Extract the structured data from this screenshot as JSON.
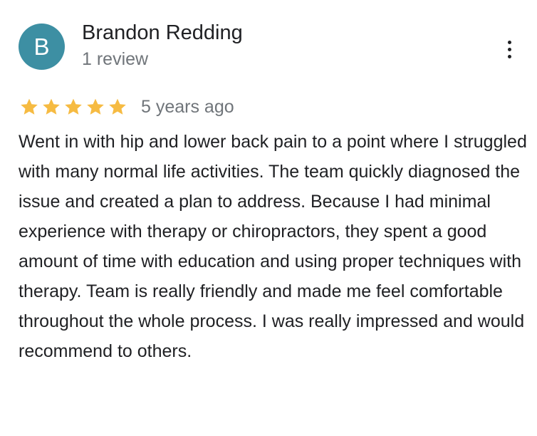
{
  "review": {
    "avatar_letter": "B",
    "avatar_color": "#3d8fa3",
    "reviewer_name": "Brandon Redding",
    "review_count": "1 review",
    "rating": 5,
    "rating_max": 5,
    "star_color": "#f6bb42",
    "time_ago": "5 years ago",
    "text": "Went in with hip and lower back pain to a point where I struggled with many normal life activities. The team quickly diagnosed the issue and created a plan to address. Because I had minimal experience with therapy or chiropractors, they spent a good amount of time with education and using proper techniques with therapy. Team is really friendly and made me feel comfortable throughout the whole process. I was really impressed and would recommend to others.",
    "more_icon": "more-vert-icon"
  }
}
